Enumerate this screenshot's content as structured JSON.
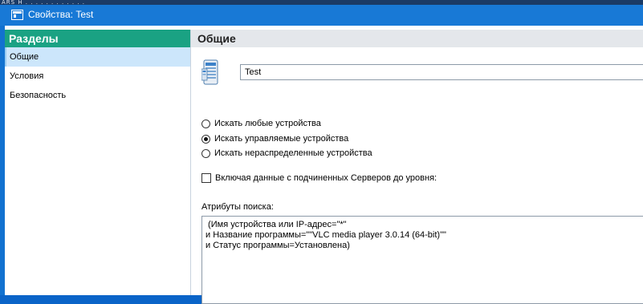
{
  "window": {
    "title": "Свойства: Test"
  },
  "sidebar": {
    "header": "Разделы",
    "items": [
      {
        "label": "Общие",
        "active": true
      },
      {
        "label": "Условия",
        "active": false
      },
      {
        "label": "Безопасность",
        "active": false
      }
    ]
  },
  "main": {
    "header": "Общие",
    "name_value": "Test",
    "radios": [
      {
        "label": "Искать любые устройства",
        "checked": false
      },
      {
        "label": "Искать управляемые устройства",
        "checked": true
      },
      {
        "label": "Искать нераспределенные устройства",
        "checked": false
      }
    ],
    "include_slave_label": "Включая данные с подчиненных Серверов до уровня:",
    "include_slave_checked": false,
    "attributes_label": "Атрибуты поиска:",
    "attributes_lines": [
      " (Имя устройства или IP-адрес=\"*\"",
      "и Название программы=\"\"VLC media player 3.0.14 (64-bit)\"\"",
      "и Статус программы=Установлена)"
    ]
  },
  "colors": {
    "titlebar": "#1879d6",
    "sidebar_header": "#1aa283",
    "active_item": "#cce6fb"
  }
}
